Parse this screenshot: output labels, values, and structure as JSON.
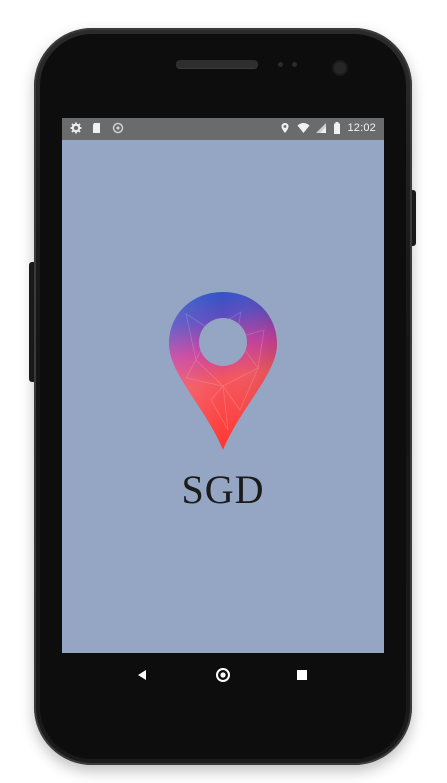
{
  "status_bar": {
    "time": "12:02",
    "left_icons": [
      "settings-icon",
      "sd-card-icon",
      "sync-icon"
    ],
    "right_icons": [
      "location-icon",
      "wifi-icon",
      "signal-icon",
      "battery-icon"
    ]
  },
  "splash": {
    "app_name": "SGD",
    "logo_icon": "map-pin-icon",
    "background_color": "#94a6c4"
  },
  "nav_bar": {
    "buttons": [
      "back-icon",
      "home-icon",
      "recents-icon"
    ]
  },
  "colors": {
    "pin_top": "#1f58c8",
    "pin_mid": "#d2429c",
    "pin_bottom": "#ff3b3b",
    "status_bar": "#6a6b6d"
  }
}
